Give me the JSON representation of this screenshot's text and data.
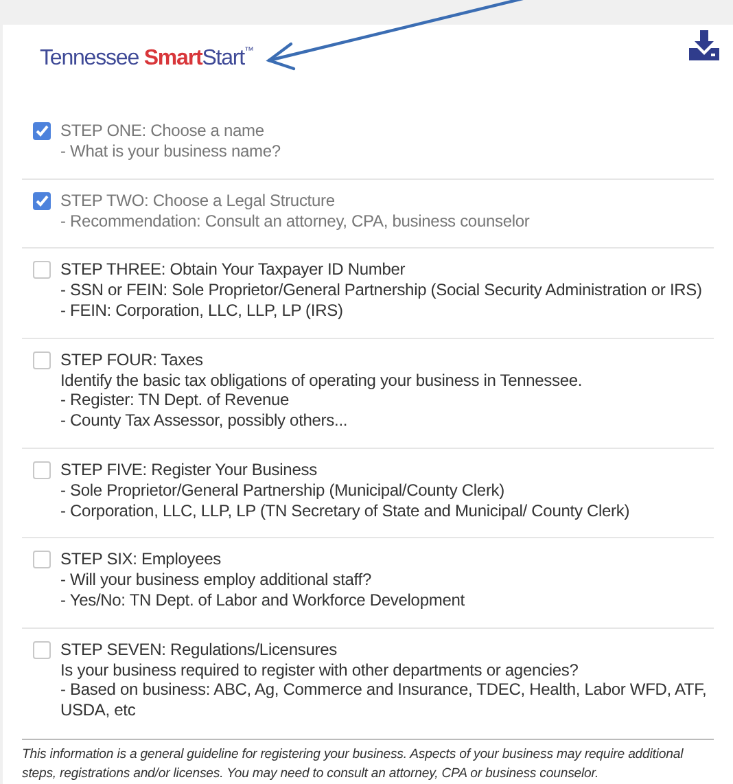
{
  "logo": {
    "state": "Tennessee",
    "brand_bold": "Smart",
    "brand": "Start",
    "mark": "™"
  },
  "steps": [
    {
      "title": "STEP ONE: Choose a name",
      "checked": true,
      "lines": [
        "- What is your business name?"
      ]
    },
    {
      "title": "STEP TWO: Choose a Legal Structure",
      "checked": true,
      "lines": [
        "- Recommendation: Consult an attorney, CPA, business counselor"
      ]
    },
    {
      "title": "STEP THREE: Obtain Your Taxpayer ID Number",
      "checked": false,
      "lines": [
        "- SSN or FEIN: Sole Proprietor/General Partnership (Social Security Administration or IRS)",
        "- FEIN: Corporation, LLC, LLP, LP (IRS)"
      ]
    },
    {
      "title": "STEP FOUR: Taxes",
      "checked": false,
      "lines": [
        "Identify the basic tax obligations of operating your business in Tennessee.",
        "- Register: TN Dept. of Revenue",
        "- County Tax Assessor, possibly others..."
      ]
    },
    {
      "title": "STEP FIVE: Register Your Business",
      "checked": false,
      "lines": [
        "- Sole Proprietor/General Partnership (Municipal/County Clerk)",
        "- Corporation, LLC, LLP, LP (TN Secretary of State and Municipal/ County Clerk)"
      ]
    },
    {
      "title": "STEP SIX: Employees",
      "checked": false,
      "lines": [
        "- Will your business employ additional staff?",
        "- Yes/No: TN Dept. of Labor and Workforce Development"
      ]
    },
    {
      "title": "STEP SEVEN: Regulations/Licensures",
      "checked": false,
      "lines": [
        "Is your business required to register with other departments or agencies?",
        "- Based on business: ABC, Ag, Commerce and Insurance, TDEC, Health, Labor WFD, ATF, USDA, etc"
      ]
    }
  ],
  "disclaimer": "This information is a general guideline for registering your business. Aspects of your business may require additional steps, registrations and/or licenses. You may need to consult an attorney, CPA or business counselor."
}
